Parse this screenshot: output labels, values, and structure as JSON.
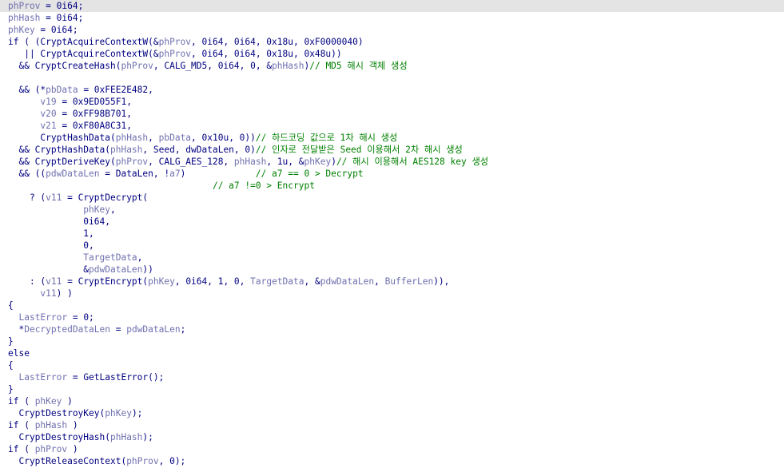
{
  "editor": {
    "current_line_index": 0,
    "lines": [
      [
        {
          "k": "v",
          "s": "phProv"
        },
        {
          "k": "t",
          "s": " = 0i64;"
        }
      ],
      [
        {
          "k": "v",
          "s": "phHash"
        },
        {
          "k": "t",
          "s": " = 0i64;"
        }
      ],
      [
        {
          "k": "v",
          "s": "phKey"
        },
        {
          "k": "t",
          "s": " = 0i64;"
        }
      ],
      [
        {
          "k": "t",
          "s": "if ( (CryptAcquireContextW(&"
        },
        {
          "k": "v",
          "s": "phProv"
        },
        {
          "k": "t",
          "s": ", 0i64, 0i64, 0x18u, 0xF0000040)"
        }
      ],
      [
        {
          "k": "t",
          "s": "   || CryptAcquireContextW(&"
        },
        {
          "k": "v",
          "s": "phProv"
        },
        {
          "k": "t",
          "s": ", 0i64, 0i64, 0x18u, 0x48u))"
        }
      ],
      [
        {
          "k": "t",
          "s": "  && CryptCreateHash("
        },
        {
          "k": "v",
          "s": "phProv"
        },
        {
          "k": "t",
          "s": ", CALG_MD5, 0i64, 0, &"
        },
        {
          "k": "v",
          "s": "phHash"
        },
        {
          "k": "t",
          "s": ")"
        },
        {
          "k": "c",
          "s": "// MD5 해시 객체 생성"
        }
      ],
      [],
      [
        {
          "k": "t",
          "s": "  && (*"
        },
        {
          "k": "v",
          "s": "pbData"
        },
        {
          "k": "t",
          "s": " = 0xFEE2E482,"
        }
      ],
      [
        {
          "k": "t",
          "s": "      "
        },
        {
          "k": "v",
          "s": "v19"
        },
        {
          "k": "t",
          "s": " = 0x9ED055F1,"
        }
      ],
      [
        {
          "k": "t",
          "s": "      "
        },
        {
          "k": "v",
          "s": "v20"
        },
        {
          "k": "t",
          "s": " = 0xFF98B701,"
        }
      ],
      [
        {
          "k": "t",
          "s": "      "
        },
        {
          "k": "v",
          "s": "v21"
        },
        {
          "k": "t",
          "s": " = 0xF80A8C31,"
        }
      ],
      [
        {
          "k": "t",
          "s": "      CryptHashData("
        },
        {
          "k": "v",
          "s": "phHash"
        },
        {
          "k": "t",
          "s": ", "
        },
        {
          "k": "v",
          "s": "pbData"
        },
        {
          "k": "t",
          "s": ", 0x10u, 0))"
        },
        {
          "k": "c",
          "s": "// 하드코딩 값으로 1차 해시 생성"
        }
      ],
      [
        {
          "k": "t",
          "s": "  && CryptHashData("
        },
        {
          "k": "v",
          "s": "phHash"
        },
        {
          "k": "t",
          "s": ", Seed, dwDataLen, 0)"
        },
        {
          "k": "c",
          "s": "// 인자로 전달받은 Seed 이용해서 2차 해시 생성"
        }
      ],
      [
        {
          "k": "t",
          "s": "  && CryptDeriveKey("
        },
        {
          "k": "v",
          "s": "phProv"
        },
        {
          "k": "t",
          "s": ", CALG_AES_128, "
        },
        {
          "k": "v",
          "s": "phHash"
        },
        {
          "k": "t",
          "s": ", 1u, &"
        },
        {
          "k": "v",
          "s": "phKey"
        },
        {
          "k": "t",
          "s": ")"
        },
        {
          "k": "c",
          "s": "// 해시 이용해서 AES128 key 생성"
        }
      ],
      [
        {
          "k": "t",
          "s": "  && (("
        },
        {
          "k": "v",
          "s": "pdwDataLen"
        },
        {
          "k": "t",
          "s": " = DataLen, !"
        },
        {
          "k": "v",
          "s": "a7"
        },
        {
          "k": "t",
          "s": ")             "
        },
        {
          "k": "c",
          "s": "// a7 == 0 > Decrypt"
        }
      ],
      [
        {
          "k": "t",
          "s": "                                      "
        },
        {
          "k": "c",
          "s": "// a7 !=0 > Encrypt"
        }
      ],
      [
        {
          "k": "t",
          "s": "    ? ("
        },
        {
          "k": "v",
          "s": "v11"
        },
        {
          "k": "t",
          "s": " = CryptDecrypt("
        }
      ],
      [
        {
          "k": "t",
          "s": "              "
        },
        {
          "k": "v",
          "s": "phKey"
        },
        {
          "k": "t",
          "s": ","
        }
      ],
      [
        {
          "k": "t",
          "s": "              0i64,"
        }
      ],
      [
        {
          "k": "t",
          "s": "              1,"
        }
      ],
      [
        {
          "k": "t",
          "s": "              0,"
        }
      ],
      [
        {
          "k": "t",
          "s": "              "
        },
        {
          "k": "v",
          "s": "TargetData"
        },
        {
          "k": "t",
          "s": ","
        }
      ],
      [
        {
          "k": "t",
          "s": "              &"
        },
        {
          "k": "v",
          "s": "pdwDataLen"
        },
        {
          "k": "t",
          "s": "))"
        }
      ],
      [
        {
          "k": "t",
          "s": "    : ("
        },
        {
          "k": "v",
          "s": "v11"
        },
        {
          "k": "t",
          "s": " = CryptEncrypt("
        },
        {
          "k": "v",
          "s": "phKey"
        },
        {
          "k": "t",
          "s": ", 0i64, 1, 0, "
        },
        {
          "k": "v",
          "s": "TargetData"
        },
        {
          "k": "t",
          "s": ", &"
        },
        {
          "k": "v",
          "s": "pdwDataLen"
        },
        {
          "k": "t",
          "s": ", "
        },
        {
          "k": "v",
          "s": "BufferLen"
        },
        {
          "k": "t",
          "s": ")),"
        }
      ],
      [
        {
          "k": "t",
          "s": "      "
        },
        {
          "k": "v",
          "s": "v11"
        },
        {
          "k": "t",
          "s": ") )"
        }
      ],
      [
        {
          "k": "t",
          "s": "{"
        }
      ],
      [
        {
          "k": "t",
          "s": "  "
        },
        {
          "k": "v",
          "s": "LastError"
        },
        {
          "k": "t",
          "s": " = 0;"
        }
      ],
      [
        {
          "k": "t",
          "s": "  *"
        },
        {
          "k": "v",
          "s": "DecryptedDataLen"
        },
        {
          "k": "t",
          "s": " = "
        },
        {
          "k": "v",
          "s": "pdwDataLen"
        },
        {
          "k": "t",
          "s": ";"
        }
      ],
      [
        {
          "k": "t",
          "s": "}"
        }
      ],
      [
        {
          "k": "t",
          "s": "else"
        }
      ],
      [
        {
          "k": "t",
          "s": "{"
        }
      ],
      [
        {
          "k": "t",
          "s": "  "
        },
        {
          "k": "v",
          "s": "LastError"
        },
        {
          "k": "t",
          "s": " = GetLastError();"
        }
      ],
      [
        {
          "k": "t",
          "s": "}"
        }
      ],
      [
        {
          "k": "t",
          "s": "if ( "
        },
        {
          "k": "v",
          "s": "phKey"
        },
        {
          "k": "t",
          "s": " )"
        }
      ],
      [
        {
          "k": "t",
          "s": "  CryptDestroyKey("
        },
        {
          "k": "v",
          "s": "phKey"
        },
        {
          "k": "t",
          "s": ");"
        }
      ],
      [
        {
          "k": "t",
          "s": "if ( "
        },
        {
          "k": "v",
          "s": "phHash"
        },
        {
          "k": "t",
          "s": " )"
        }
      ],
      [
        {
          "k": "t",
          "s": "  CryptDestroyHash("
        },
        {
          "k": "v",
          "s": "phHash"
        },
        {
          "k": "t",
          "s": ");"
        }
      ],
      [
        {
          "k": "t",
          "s": "if ( "
        },
        {
          "k": "v",
          "s": "phProv"
        },
        {
          "k": "t",
          "s": " )"
        }
      ],
      [
        {
          "k": "t",
          "s": "  CryptReleaseContext("
        },
        {
          "k": "v",
          "s": "phProv"
        },
        {
          "k": "t",
          "s": ", 0);"
        }
      ]
    ]
  },
  "colors": {
    "background": "#ffffff",
    "current_line_highlight": "#e4e4e4",
    "code_text": "#000080",
    "variable": "#7070b0",
    "comment": "#008000"
  }
}
